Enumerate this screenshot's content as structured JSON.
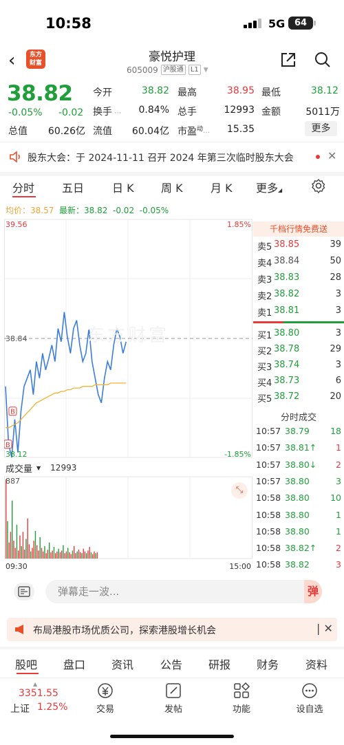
{
  "status_bar": {
    "time": "10:58",
    "network": "5G",
    "battery": "64"
  },
  "header": {
    "logo_text": [
      "东方",
      "财富"
    ],
    "title": "豪悦护理",
    "code": "605009",
    "tags": [
      "沪股通",
      "L1"
    ]
  },
  "quote": {
    "price": "38.82",
    "change_pct": "-0.05%",
    "change_amt": "-0.02",
    "open_label": "今开",
    "open": "38.82",
    "high_label": "最高",
    "high": "38.95",
    "low_label": "最低",
    "low": "38.12",
    "turnover_label": "换手",
    "turnover": "0.84%",
    "volume_label": "总手",
    "volume": "12993",
    "amount_label": "金额",
    "amount": "5011万",
    "mktcap_label": "总值",
    "mktcap": "60.26亿",
    "float_label": "流值",
    "float": "60.04亿",
    "pe_label": "市盈",
    "pe_sup": "动",
    "pe": "15.35",
    "more_label": "更多"
  },
  "notice": {
    "text": "股东大会：于 2024-11-11 召开 2024 年第三次临时股东大会"
  },
  "period_tabs": [
    "分时",
    "五日",
    "日 K",
    "周 K",
    "月 K",
    "更多"
  ],
  "avg_line": {
    "avg_label": "均价：",
    "avg": "38.57",
    "latest_label": "最新：",
    "latest": "38.82",
    "chg": "-0.02",
    "pct": "-0.05%"
  },
  "chart_data": {
    "type": "line",
    "title": "分时",
    "price_axis": {
      "top": "39.56",
      "mid": "38.84",
      "bottom": "38.12"
    },
    "pct_axis": {
      "top": "1.85%",
      "bottom": "-1.85%"
    },
    "ylim": [
      38.12,
      39.56
    ],
    "prev_close": 38.84,
    "x_labels": [
      "09:30",
      "15:00"
    ],
    "series": [
      {
        "name": "price",
        "color": "#3b7dd8",
        "values": [
          38.55,
          38.2,
          38.12,
          38.35,
          38.15,
          38.4,
          38.55,
          38.6,
          38.65,
          38.5,
          38.7,
          38.6,
          38.75,
          38.65,
          38.72,
          38.8,
          38.7,
          38.9,
          38.82,
          39.0,
          38.85,
          38.75,
          38.9,
          38.95,
          38.8,
          38.7,
          38.75,
          38.9,
          38.7,
          38.6,
          38.5,
          38.45,
          38.6,
          38.7,
          38.65,
          38.8,
          38.9,
          38.85,
          38.75,
          38.82
        ]
      },
      {
        "name": "avg",
        "color": "#f2b233",
        "values": [
          38.3,
          38.3,
          38.31,
          38.32,
          38.33,
          38.35,
          38.37,
          38.39,
          38.41,
          38.43,
          38.45,
          38.46,
          38.47,
          38.48,
          38.49,
          38.5,
          38.51,
          38.51,
          38.52,
          38.52,
          38.53,
          38.53,
          38.54,
          38.54,
          38.54,
          38.55,
          38.55,
          38.55,
          38.55,
          38.56,
          38.56,
          38.56,
          38.56,
          38.56,
          38.57,
          38.57,
          38.57,
          38.57,
          38.57,
          38.57
        ]
      }
    ],
    "volume_label": "成交量",
    "volume_total": "12993",
    "volume_axis_top": "887",
    "volume_max": 887,
    "volume_bars": [
      887,
      420,
      180,
      300,
      650,
      200,
      120,
      380,
      90,
      260,
      140,
      300,
      100,
      220,
      450,
      160,
      80,
      120,
      200,
      310,
      150,
      90,
      240,
      120,
      80,
      140,
      60,
      100,
      180,
      70,
      90,
      130,
      60,
      80,
      110,
      70,
      90,
      150,
      60,
      80,
      120,
      70,
      50,
      90,
      140,
      60,
      80,
      100,
      70,
      60,
      110,
      80,
      60,
      90,
      130,
      70,
      50,
      80,
      60,
      70
    ],
    "markers": [
      "B",
      "B"
    ],
    "watermark": "东方财富"
  },
  "order_book": {
    "banner": "千档行情免费送",
    "asks": [
      {
        "label": "卖5",
        "price": "38.85",
        "vol": "39",
        "color": "red"
      },
      {
        "label": "卖4",
        "price": "38.84",
        "vol": "50",
        "color": "gray"
      },
      {
        "label": "卖3",
        "price": "38.83",
        "vol": "28",
        "color": "green"
      },
      {
        "label": "卖2",
        "price": "38.82",
        "vol": "3",
        "color": "green"
      },
      {
        "label": "卖1",
        "price": "38.81",
        "vol": "3",
        "color": "green"
      }
    ],
    "bids": [
      {
        "label": "买1",
        "price": "38.80",
        "vol": "3",
        "color": "green"
      },
      {
        "label": "买2",
        "price": "38.78",
        "vol": "29",
        "color": "green"
      },
      {
        "label": "买3",
        "price": "38.74",
        "vol": "3",
        "color": "green"
      },
      {
        "label": "买4",
        "price": "38.73",
        "vol": "6",
        "color": "green"
      },
      {
        "label": "买5",
        "price": "38.72",
        "vol": "20",
        "color": "green"
      }
    ],
    "trades_title": "分时成交",
    "trades": [
      {
        "time": "10:57",
        "price": "38.79",
        "vol": "18",
        "pc": "green",
        "vc": "green"
      },
      {
        "time": "10:57",
        "price": "38.81↑",
        "vol": "1",
        "pc": "green",
        "vc": "red"
      },
      {
        "time": "10:57",
        "price": "38.80↓",
        "vol": "2",
        "pc": "green",
        "vc": "red"
      },
      {
        "time": "10:57",
        "price": "38.80",
        "vol": "3",
        "pc": "green",
        "vc": "green"
      },
      {
        "time": "10:58",
        "price": "38.80",
        "vol": "10",
        "pc": "green",
        "vc": "green"
      },
      {
        "time": "10:58",
        "price": "38.80",
        "vol": "1",
        "pc": "green",
        "vc": "green"
      },
      {
        "time": "10:58",
        "price": "38.80",
        "vol": "1",
        "pc": "green",
        "vc": "green"
      },
      {
        "time": "10:58",
        "price": "38.82↑",
        "vol": "2",
        "pc": "green",
        "vc": "red"
      },
      {
        "time": "10:58",
        "price": "38.82",
        "vol": "3",
        "pc": "green",
        "vc": "red"
      }
    ]
  },
  "danmu": {
    "placeholder": "弹幕走一波...",
    "button": "弹"
  },
  "promo": {
    "text": "布局港股市场优质公司，探索港股增长机会"
  },
  "bottom_tabs": [
    "股吧",
    "盘口",
    "资讯",
    "公告",
    "研报",
    "财务",
    "资料"
  ],
  "bottom_nav": {
    "index_value": "3351.55",
    "index_name": "上证",
    "index_pct": "1.25%",
    "items": [
      "交易",
      "发帖",
      "功能",
      "设自选"
    ]
  },
  "colors": {
    "up": "#e8393c",
    "down": "#1f9e3a",
    "brand": "#e8502a",
    "avg": "#f2b233",
    "price_line": "#3b7dd8"
  }
}
